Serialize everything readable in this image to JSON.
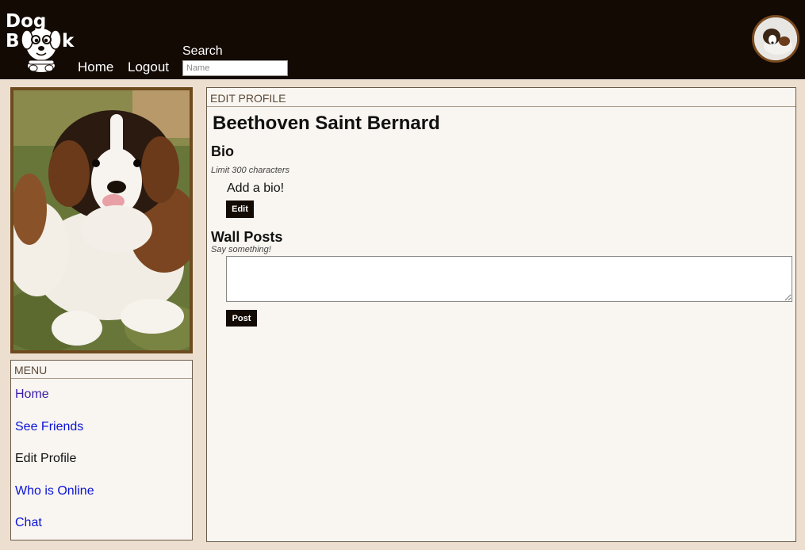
{
  "header": {
    "logo": {
      "line1": "Dog",
      "line2_left": "B",
      "line2_right": "k"
    },
    "nav": {
      "home": "Home",
      "logout": "Logout"
    },
    "search": {
      "label": "Search",
      "placeholder": "Name"
    }
  },
  "menu": {
    "title": "MENU",
    "items": [
      {
        "label": "Home",
        "state": "visited"
      },
      {
        "label": "See Friends",
        "state": "link"
      },
      {
        "label": "Edit Profile",
        "state": "current"
      },
      {
        "label": "Who is Online",
        "state": "link"
      },
      {
        "label": "Chat",
        "state": "link"
      }
    ]
  },
  "main": {
    "title": "EDIT PROFILE",
    "profile_name": "Beethoven Saint Bernard",
    "bio": {
      "heading": "Bio",
      "hint": "Limit 300 characters",
      "text": "Add a bio!",
      "edit_label": "Edit"
    },
    "wall": {
      "heading": "Wall Posts",
      "hint": "Say something!",
      "textarea_value": "",
      "post_label": "Post"
    }
  },
  "colors": {
    "header_bg": "#130a04",
    "page_bg": "#ecdfd0",
    "panel_bg": "#f9f5f0",
    "photo_border": "#6e4a1f",
    "link": "#0a14d8",
    "visited_link": "#3a1aa8"
  },
  "icons": {
    "logo": "dog-face-icon",
    "avatar": "user-avatar-photo"
  }
}
